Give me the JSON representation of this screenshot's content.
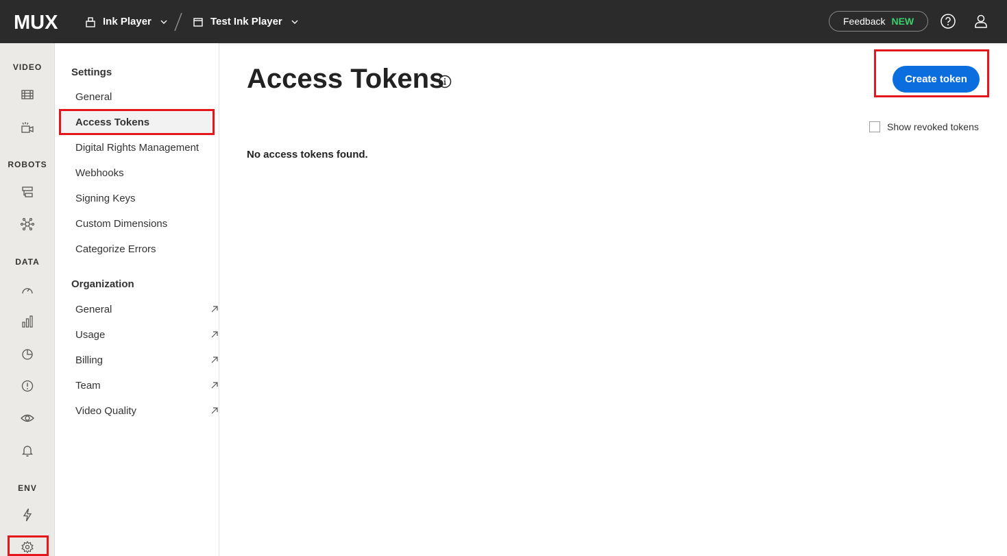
{
  "topbar": {
    "logo_text": "MUX",
    "org_name": "Ink Player",
    "env_name": "Test Ink Player",
    "feedback_label": "Feedback",
    "feedback_badge": "NEW"
  },
  "rail": {
    "sections": [
      "VIDEO",
      "ROBOTS",
      "DATA",
      "ENV"
    ]
  },
  "nav": {
    "settings_heading": "Settings",
    "settings_items": [
      "General",
      "Access Tokens",
      "Digital Rights Management",
      "Webhooks",
      "Signing Keys",
      "Custom Dimensions",
      "Categorize Errors"
    ],
    "active_item": "Access Tokens",
    "org_heading": "Organization",
    "org_items": [
      "General",
      "Usage",
      "Billing",
      "Team",
      "Video Quality"
    ]
  },
  "main": {
    "title": "Access Tokens",
    "create_label": "Create token",
    "show_revoked_label": "Show revoked tokens",
    "empty_message": "No access tokens found."
  },
  "colors": {
    "accent": "#0b6ede",
    "topbar": "#2b2b2b",
    "badge": "#3ad06e",
    "highlight": "#e5161b"
  }
}
